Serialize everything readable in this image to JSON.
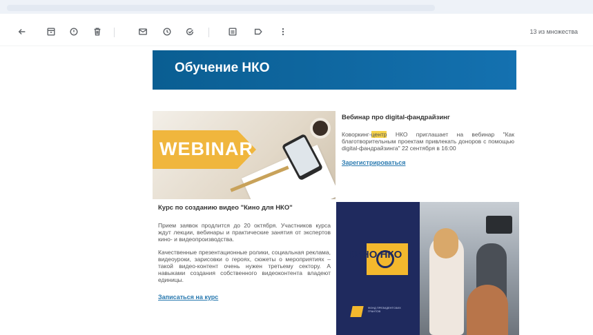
{
  "toolbar": {
    "counter": "13 из множества",
    "icons": [
      "back-arrow-icon",
      "archive-icon",
      "report-spam-icon",
      "delete-icon",
      "mark-unread-icon",
      "snooze-icon",
      "add-task-icon",
      "move-to-icon",
      "label-icon",
      "more-vert-icon"
    ]
  },
  "email": {
    "banner_title": "Обучение НКО",
    "webinar_image_text": "WEBINAR",
    "webinar": {
      "title": "Вебинар про digital-фандрайзинг",
      "text_before": "Коворкинг-",
      "text_highlight": "центр",
      "text_after": " НКО приглашает на вебинар \"Как благотворительным проектам привлекать доноров с помощью digital-фандрайзинга\" 22 сентября в 16:00",
      "link": "Зарегистрироваться"
    },
    "course": {
      "title": "Курс по созданию видео \"Кино для НКО\"",
      "paragraph1": "Прием заявок продлится до 20 октября. Участников курса ждут лекции, вебинары и практические занятия от экспертов кино- и видеопроизводства.",
      "paragraph2": "Качественные презентационные ролики, социальная реклама, видеоуроки, зарисовки о героях, сюжеты о мероприятиях – такой видео-контент очень нужен третьему сектору. А навыками создания собственного видеоконтента владеют единицы.",
      "link": "Записаться на курс"
    },
    "kino_logo_text": "КИНО НКО",
    "fund_text": "ФОНД ПРЕЗИДЕНТСКИХ ГРАНТОВ"
  },
  "colors": {
    "banner": "#0a5e92",
    "link": "#2a7ab0",
    "highlight": "#f6d34a",
    "kino_navy": "#1f2a5e",
    "kino_yellow": "#f3b82d"
  }
}
